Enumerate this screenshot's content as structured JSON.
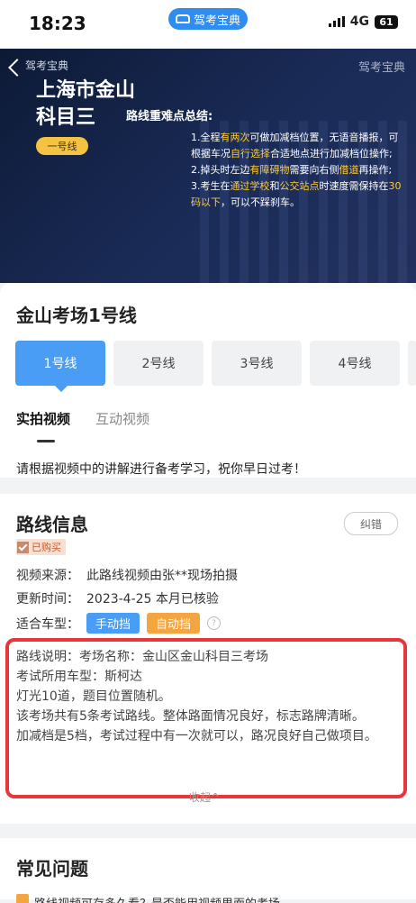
{
  "status_bar": {
    "time": "18:23",
    "app_pill": "驾考宝典",
    "network": "4G",
    "battery": "61"
  },
  "banner": {
    "brand": "驾考宝典",
    "watermark": "驾考宝典",
    "title_line1": "上海市金山",
    "title_line2": "科目三",
    "line_tag": "一号线",
    "subtitle": "路线重难点总结:",
    "points": [
      {
        "pre": "1.全程",
        "hl1": "有两次",
        "mid": "可做加减档位置，无语音播报，可根据车况",
        "hl2": "自行选择",
        "post": "合适地点进行加减档位操作;"
      },
      {
        "pre": "2.掉头时左边",
        "hl1": "有障碍物",
        "mid": "需要向右侧",
        "hl2": "借道",
        "post": "再操作;"
      },
      {
        "pre": "3.考生在",
        "hl1": "通过学校",
        "mid": "和",
        "hl2": "公交站点",
        "post": "时速度需保持在",
        "hl3": "30码以下",
        "tail": "，可以不踩刹车。"
      }
    ]
  },
  "exam": {
    "title": "金山考场1号线",
    "lines": [
      "1号线",
      "2号线",
      "3号线",
      "4号线"
    ],
    "video_tabs": [
      "实拍视频",
      "互动视频"
    ],
    "notice": "请根据视频中的讲解进行备考学习，祝你早日过考！"
  },
  "route": {
    "title": "路线信息",
    "correct_button": "纠错",
    "purchased": "已购买",
    "source_label": "视频来源：",
    "source_value": "此路线视频由张**现场拍摄",
    "updated_label": "更新时间：",
    "updated_value": "2023-4-25 本月已核验",
    "car_type_label": "适合车型：",
    "car_manual": "手动挡",
    "car_auto": "自动挡",
    "help_glyph": "?",
    "desc": [
      "路线说明：考场名称：金山区金山科目三考场",
      "考试所用车型：斯柯达",
      "灯光10道，题目位置随机。",
      "该考场共有5条考试路线。整体路面情况良好，标志路牌清晰。",
      "加减档是5档，考试过程中有一次就可以，路况良好自己做项目。"
    ],
    "collapse": "收起^"
  },
  "faq": {
    "title": "常见问题",
    "first_item": "路线视频可存多久看？是否能用视频里面的考场"
  }
}
